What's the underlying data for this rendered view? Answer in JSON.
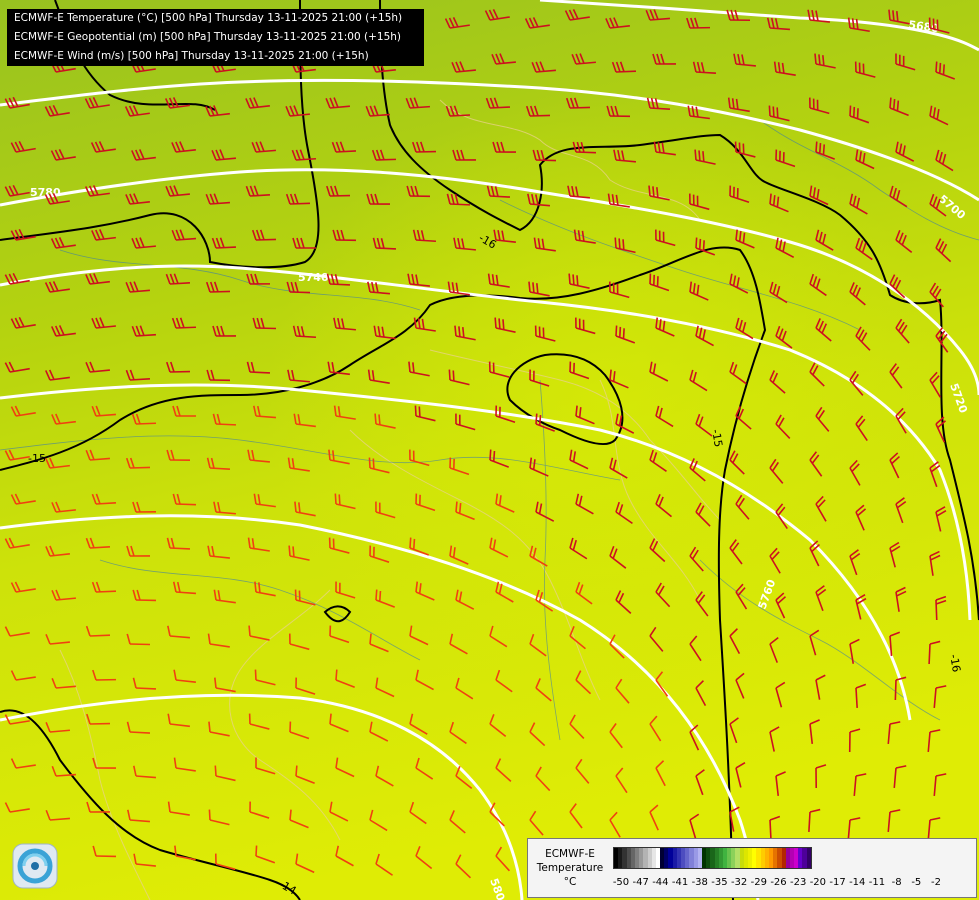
{
  "titles": [
    "ECMWF-E Temperature (°C) [500 hPa] Thursday 13-11-2025 21:00 (+15h)",
    "ECMWF-E Geopotential (m) [500 hPa] Thursday 13-11-2025 21:00 (+15h)",
    "ECMWF-E Wind (m/s) [500 hPa] Thursday 13-11-2025 21:00 (+15h)"
  ],
  "legend": {
    "title_line1": "ECMWF-E",
    "title_line2": "Temperature",
    "unit": "°C",
    "ticks": [
      "-50",
      "-47",
      "-44",
      "-41",
      "-38",
      "-35",
      "-32",
      "-29",
      "-26",
      "-23",
      "-20",
      "-17",
      "-14",
      "-11",
      "-8",
      "-5",
      "-2"
    ],
    "colors": [
      "#000000",
      "#1a1a1a",
      "#333333",
      "#4d4d4d",
      "#666666",
      "#808080",
      "#999999",
      "#b3b3b3",
      "#cccccc",
      "#e6e6e6",
      "#ffffff",
      "#000033",
      "#000066",
      "#000099",
      "#1a1aa6",
      "#3333b3",
      "#4d4dc0",
      "#6666cc",
      "#8080d9",
      "#9999e6",
      "#b3b3f2",
      "#003300",
      "#0d4d0d",
      "#1a661a",
      "#268026",
      "#339933",
      "#40b340",
      "#66c24d",
      "#8cd15a",
      "#b3e066",
      "#c8dc0a",
      "#dde600",
      "#eef000",
      "#ffff00",
      "#ffe600",
      "#ffcc00",
      "#ffb300",
      "#ff9900",
      "#e67300",
      "#cc4d00",
      "#b32600",
      "#990099",
      "#b300b3",
      "#cc00cc",
      "#6600cc",
      "#4d0099",
      "#330066"
    ]
  },
  "geopotential_labels": [
    "5680",
    "5700",
    "5720",
    "5740",
    "5760",
    "5780",
    "5800"
  ],
  "temperature_labels": [
    "-16",
    "-15",
    "-15",
    "-14",
    "-16"
  ],
  "colors": {
    "field_north": "#9bc41e",
    "field_mid": "#c6de0a",
    "field_south": "#dcea04",
    "barb_north": "#cc1020",
    "barb_south": "#f04010",
    "isohypse": "#ffffff",
    "isotherm": "#000000"
  }
}
